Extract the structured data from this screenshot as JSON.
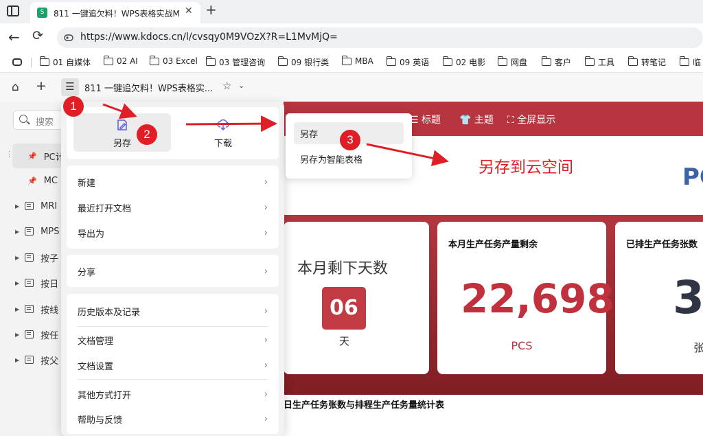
{
  "browser": {
    "tab_title": "811 一键追欠料！WPS表格实战M",
    "tab_favicon_text": "S",
    "url": "https://www.kdocs.cn/l/cvsqy0M9VOzX?R=L1MvMjQ="
  },
  "bookmarks": [
    "01 自媒体",
    "02 AI",
    "03 Excel",
    "03 管理咨询",
    "09 银行类",
    "MBA",
    "09 英语",
    "02 电影",
    "网盘",
    "客户",
    "工具",
    "转笔记",
    "临"
  ],
  "toolbar": {
    "doc_title": "811 一键追欠料！WPS表格实..."
  },
  "sidebar": {
    "search_placeholder": "搜索",
    "items": [
      {
        "label": "PC计",
        "type": "pin"
      },
      {
        "label": "MC",
        "type": "pin"
      },
      {
        "label": "MRI",
        "type": "list"
      },
      {
        "label": "MPS",
        "type": "list"
      },
      {
        "label": "按子",
        "type": "list"
      },
      {
        "label": "按日",
        "type": "list"
      },
      {
        "label": "按线",
        "type": "list"
      },
      {
        "label": "按任",
        "type": "list"
      },
      {
        "label": "按父",
        "type": "list"
      }
    ]
  },
  "dashboard": {
    "banner_items": [
      "标题",
      "主题",
      "全屏显示"
    ],
    "pc_heading": "PC",
    "days_title": "本月剩下天数",
    "days_value": "06",
    "days_unit": "天",
    "card2_title": "本月生产任务产量剩余",
    "card2_value": "22,698",
    "card2_unit": "PCS",
    "card3_title": "已排生产任务张数",
    "card3_value": "3",
    "card3_unit": "张",
    "section_title": "日生产任务张数与排程生产任务量统计表"
  },
  "menu": {
    "quick_actions": [
      {
        "label": "另存",
        "icon": "save-as-icon"
      },
      {
        "label": "下载",
        "icon": "download-icon"
      }
    ],
    "group1": [
      "新建",
      "最近打开文档",
      "导出为"
    ],
    "group2": [
      "分享"
    ],
    "group3": [
      "历史版本及记录",
      "文档管理",
      "文档设置",
      "其他方式打开",
      "帮助与反馈"
    ]
  },
  "submenu": {
    "items": [
      "另存",
      "另存为智能表格"
    ]
  },
  "annotations": {
    "steps": [
      "1",
      "2",
      "3"
    ],
    "caption": "另存到云空间",
    "color": "#e01e25"
  },
  "colors": {
    "banner": "#b7353f",
    "accent_red": "#c23a44",
    "value_red": "#c0313d",
    "pc_blue": "#3d62a8"
  }
}
